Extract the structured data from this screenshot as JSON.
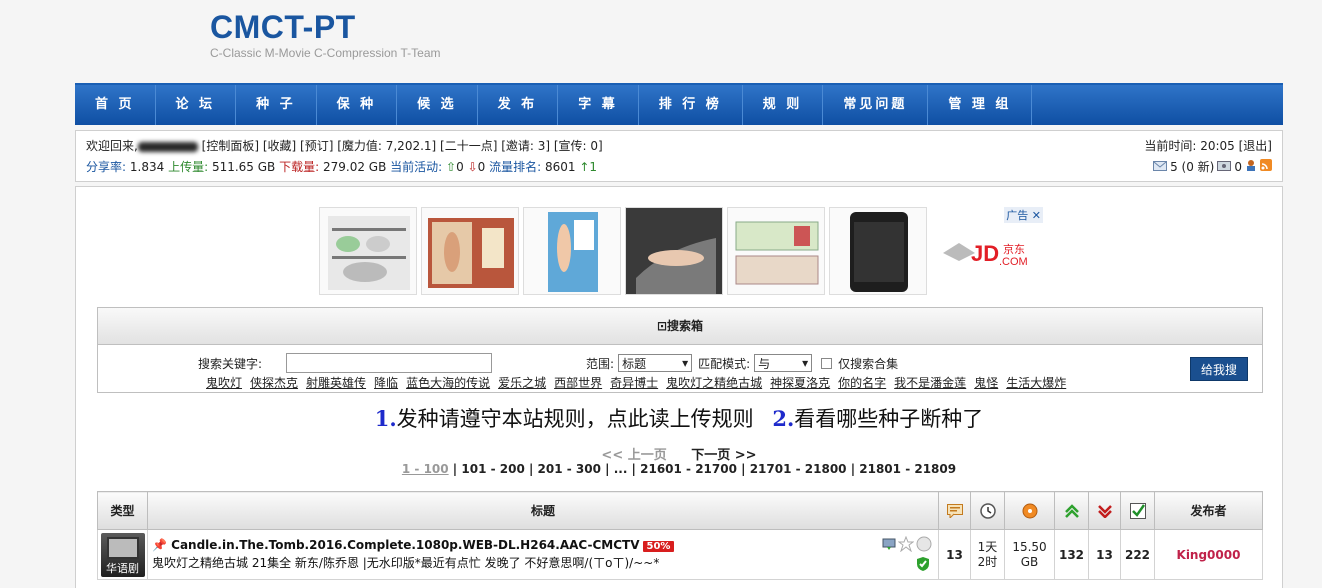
{
  "logo": {
    "title": "CMCT-PT",
    "subtitle": "C-Classic M-Movie C-Compression T-Team"
  },
  "nav": [
    "首 页",
    "论 坛",
    "种 子",
    "保 种",
    "候 选",
    "发 布",
    "字 幕",
    "排 行 榜",
    "规 则",
    "常见问题",
    "管 理 组"
  ],
  "userbar": {
    "welcome": "欢迎回来,",
    "links": "[控制面板] [收藏] [预订] [魔力值: 7,202.1] [二十一点] [邀请: 3] [宣传: 0]",
    "ratio_label": "分享率:",
    "ratio": "1.834",
    "up_label": "上传量:",
    "up": "511.65 GB",
    "down_label": "下载量:",
    "down": "279.02 GB",
    "active_label": "当前活动:",
    "seeding": "0",
    "leeching": "0",
    "rank_label": "流量排名:",
    "rank": "8601",
    "rank_change": "↑1",
    "time": "当前时间: 20:05 [退出]",
    "messages": "5 (0 新)",
    "msg2": "0"
  },
  "ads": {
    "tag": "广告",
    "jd": "JD.COM 京东"
  },
  "search": {
    "title": "⊡搜索箱",
    "keyword_label": "搜索关键字:",
    "scope_label": "范围:",
    "scope_value": "标题",
    "match_label": "匹配模式:",
    "match_value": "与",
    "collection_label": "仅搜索合集",
    "button": "给我搜",
    "hot": [
      "鬼吹灯",
      "侠探杰克",
      "射雕英雄传",
      "降临",
      "蓝色大海的传说",
      "爱乐之城",
      "西部世界",
      "奇异博士",
      "鬼吹灯之精绝古城",
      "神探夏洛克",
      "你的名字",
      "我不是潘金莲",
      "鬼怪",
      "生活大爆炸"
    ]
  },
  "notice": {
    "n1": "1.",
    "t1": "发种请遵守本站规则，点此读上传规则",
    "n2": "2.",
    "t2": "看看哪些种子断种了"
  },
  "pager": {
    "prev": "<< 上一页",
    "next": "下一页 >>",
    "current": "1 - 100",
    "rest": " | 101 - 200 | 201 - 300 | ... | 21601 - 21700 | 21701 - 21800 | 21801 - 21809"
  },
  "table": {
    "headers": {
      "type": "类型",
      "title": "标题",
      "uploader": "发布者"
    },
    "rows": [
      {
        "type": "华语剧",
        "name": "Candle.in.The.Tomb.2016.Complete.1080p.WEB-DL.H264.AAC-CMCTV",
        "promo": "50%",
        "sub": "鬼吹灯之精绝古城 21集全 新东/陈乔恩 |无水印版*最近有点忙 发晚了 不好意思啊/(ㄒoㄒ)/~~*",
        "comments": "13",
        "age": "1天\n2时",
        "size": "15.50\nGB",
        "seeders": "132",
        "leechers": "13",
        "completed": "222",
        "uploader": "King0000"
      }
    ]
  }
}
